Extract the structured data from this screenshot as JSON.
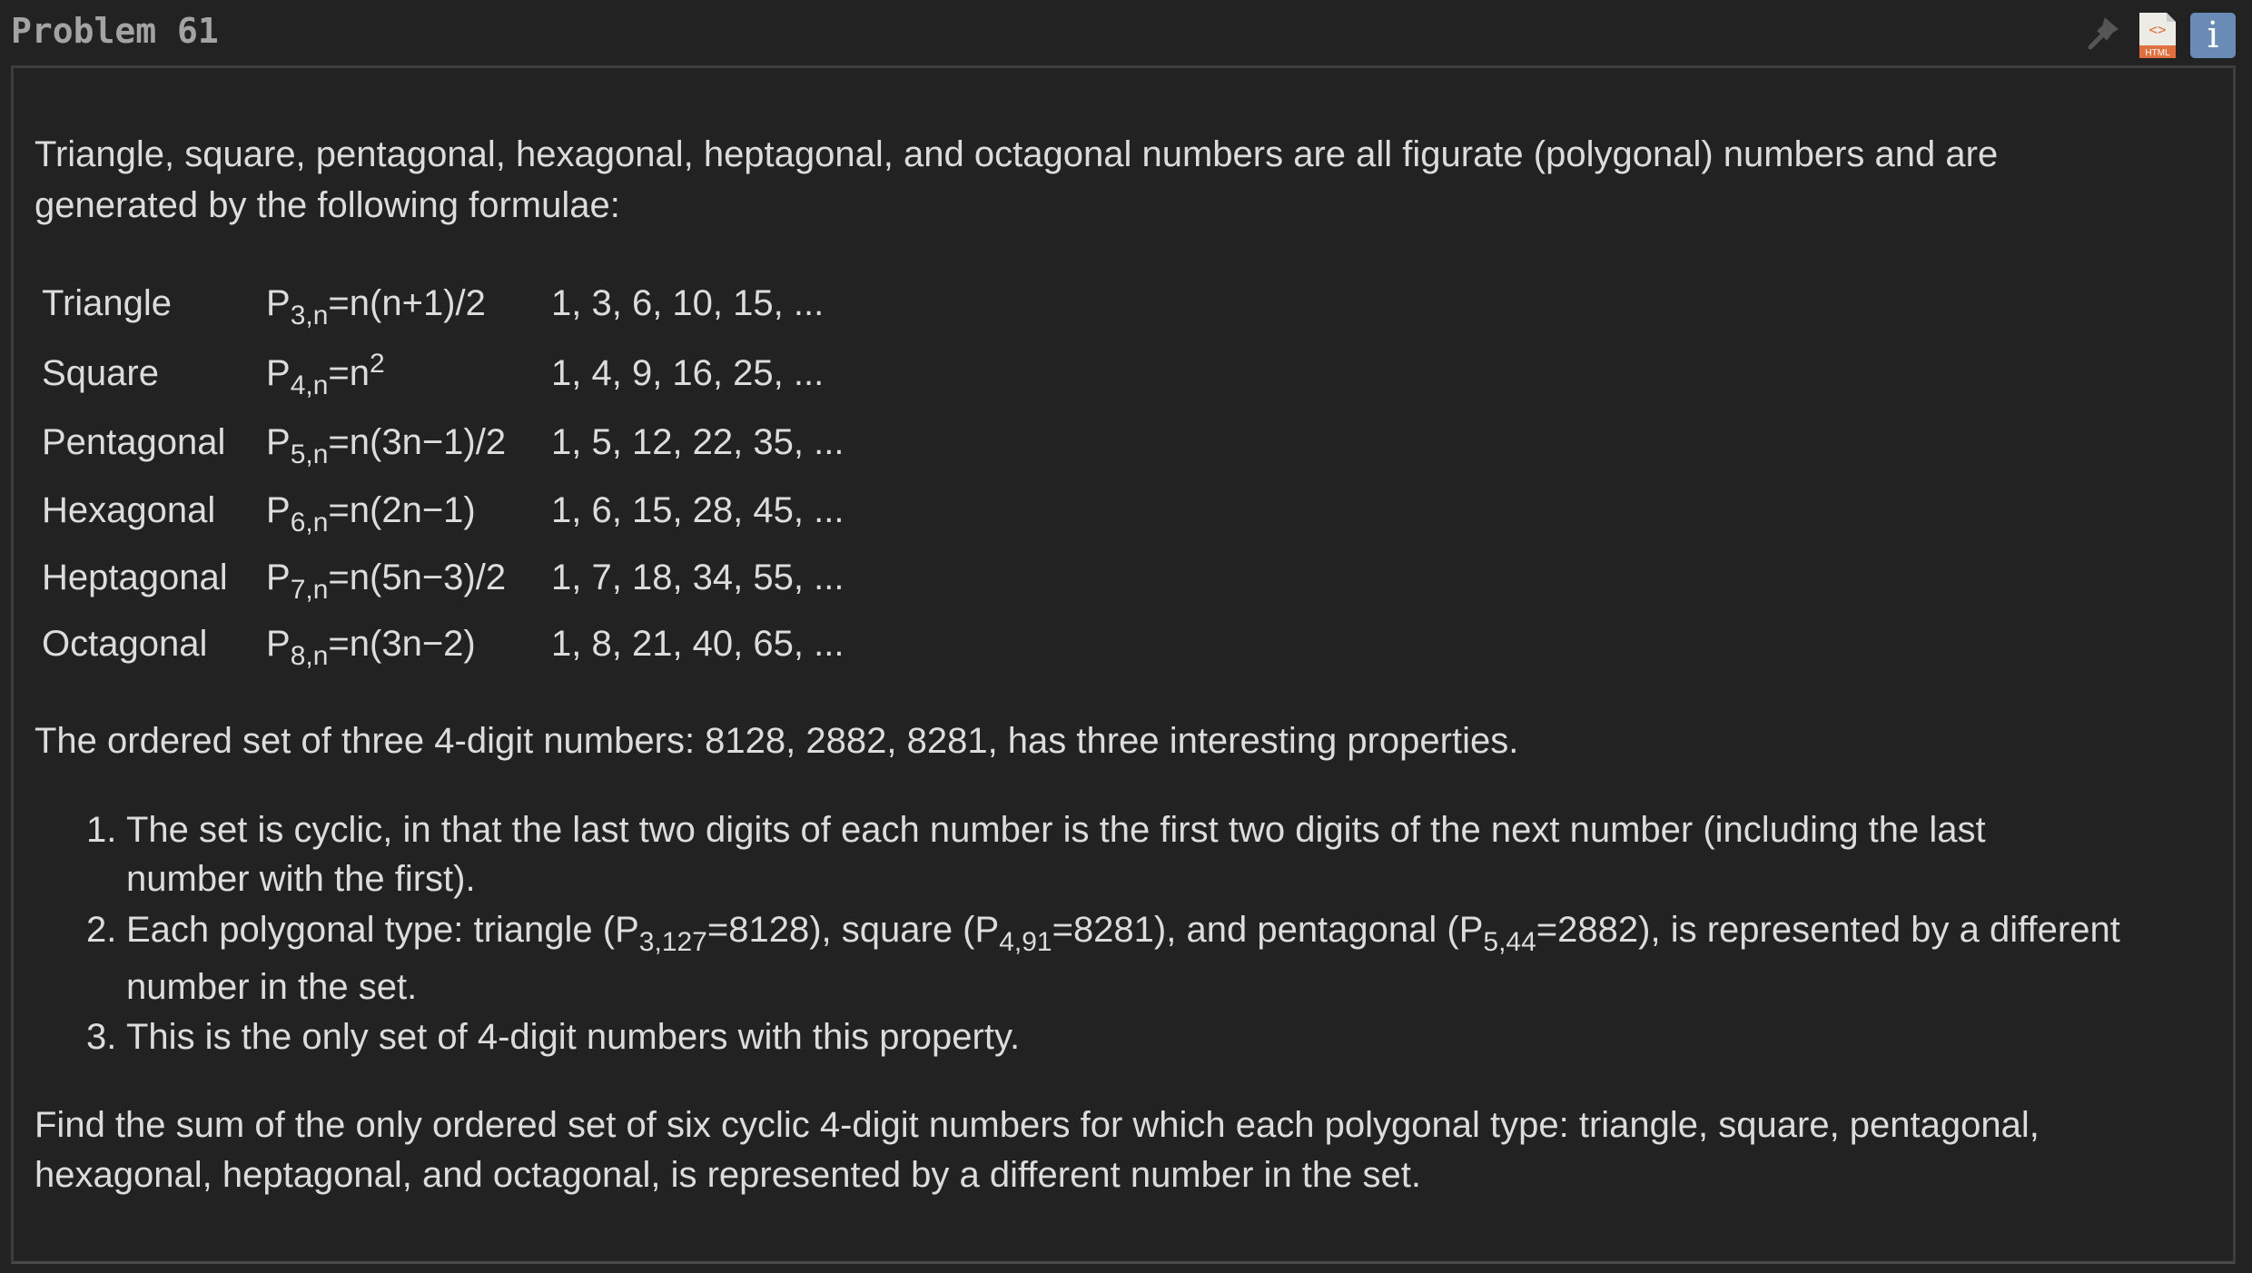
{
  "header": {
    "title": "Problem 61",
    "icons": [
      "pin-icon",
      "html-file-icon",
      "info-icon"
    ],
    "html_label": "HTML",
    "info_label": "i"
  },
  "intro": [
    "Triangle, square, pentagonal, hexagonal, heptagonal, and octagonal numbers are all figurate (polygonal) numbers and are",
    "generated by the following formulae:"
  ],
  "table": [
    {
      "name": "Triangle",
      "p": "P",
      "sub": "3,n",
      "expr": "=n(n+1)/2",
      "seq": "1, 3, 6, 10, 15, ..."
    },
    {
      "name": "Square",
      "p": "P",
      "sub": "4,n",
      "expr": "=n",
      "sup": "2",
      "seq": "1, 4, 9, 16, 25, ..."
    },
    {
      "name": "Pentagonal",
      "p": "P",
      "sub": "5,n",
      "expr": "=n(3n−1)/2",
      "seq": "1, 5, 12, 22, 35, ..."
    },
    {
      "name": "Hexagonal",
      "p": "P",
      "sub": "6,n",
      "expr": "=n(2n−1)",
      "seq": "1, 6, 15, 28, 45, ..."
    },
    {
      "name": "Heptagonal",
      "p": "P",
      "sub": "7,n",
      "expr": "=n(5n−3)/2",
      "seq": "1, 7, 18, 34, 55, ..."
    },
    {
      "name": "Octagonal",
      "p": "P",
      "sub": "8,n",
      "expr": "=n(3n−2)",
      "seq": "1, 8, 21, 40, 65, ..."
    }
  ],
  "statement": "The ordered set of three 4-digit numbers: 8128, 2882, 8281, has three interesting properties.",
  "list": {
    "item1": {
      "num": "1.",
      "lines": [
        "The set is cyclic, in that the last two digits of each number is the first two digits of the next number (including the last",
        "number with the first)."
      ]
    },
    "item2": {
      "num": "2.",
      "a": "Each polygonal type: triangle (P",
      "s1": "3,127",
      "b": "=8128), square (P",
      "s2": "4,91",
      "c": "=8281), and pentagonal (P",
      "s3": "5,44",
      "d": "=2882), is represented by a different",
      "line2": "number in the set."
    },
    "item3": {
      "num": "3.",
      "text": "This is the only set of 4-digit numbers with this property."
    }
  },
  "question": [
    "Find the sum of the only ordered set of six cyclic 4-digit numbers for which each polygonal type: triangle, square, pentagonal,",
    "hexagonal, heptagonal, and octagonal, is represented by a different number in the set."
  ],
  "colors": {
    "background": "#222222",
    "text": "#dcdcdc",
    "title": "#a3a3a3",
    "info": "#6a8bb5",
    "html_icon": "#e07040"
  }
}
